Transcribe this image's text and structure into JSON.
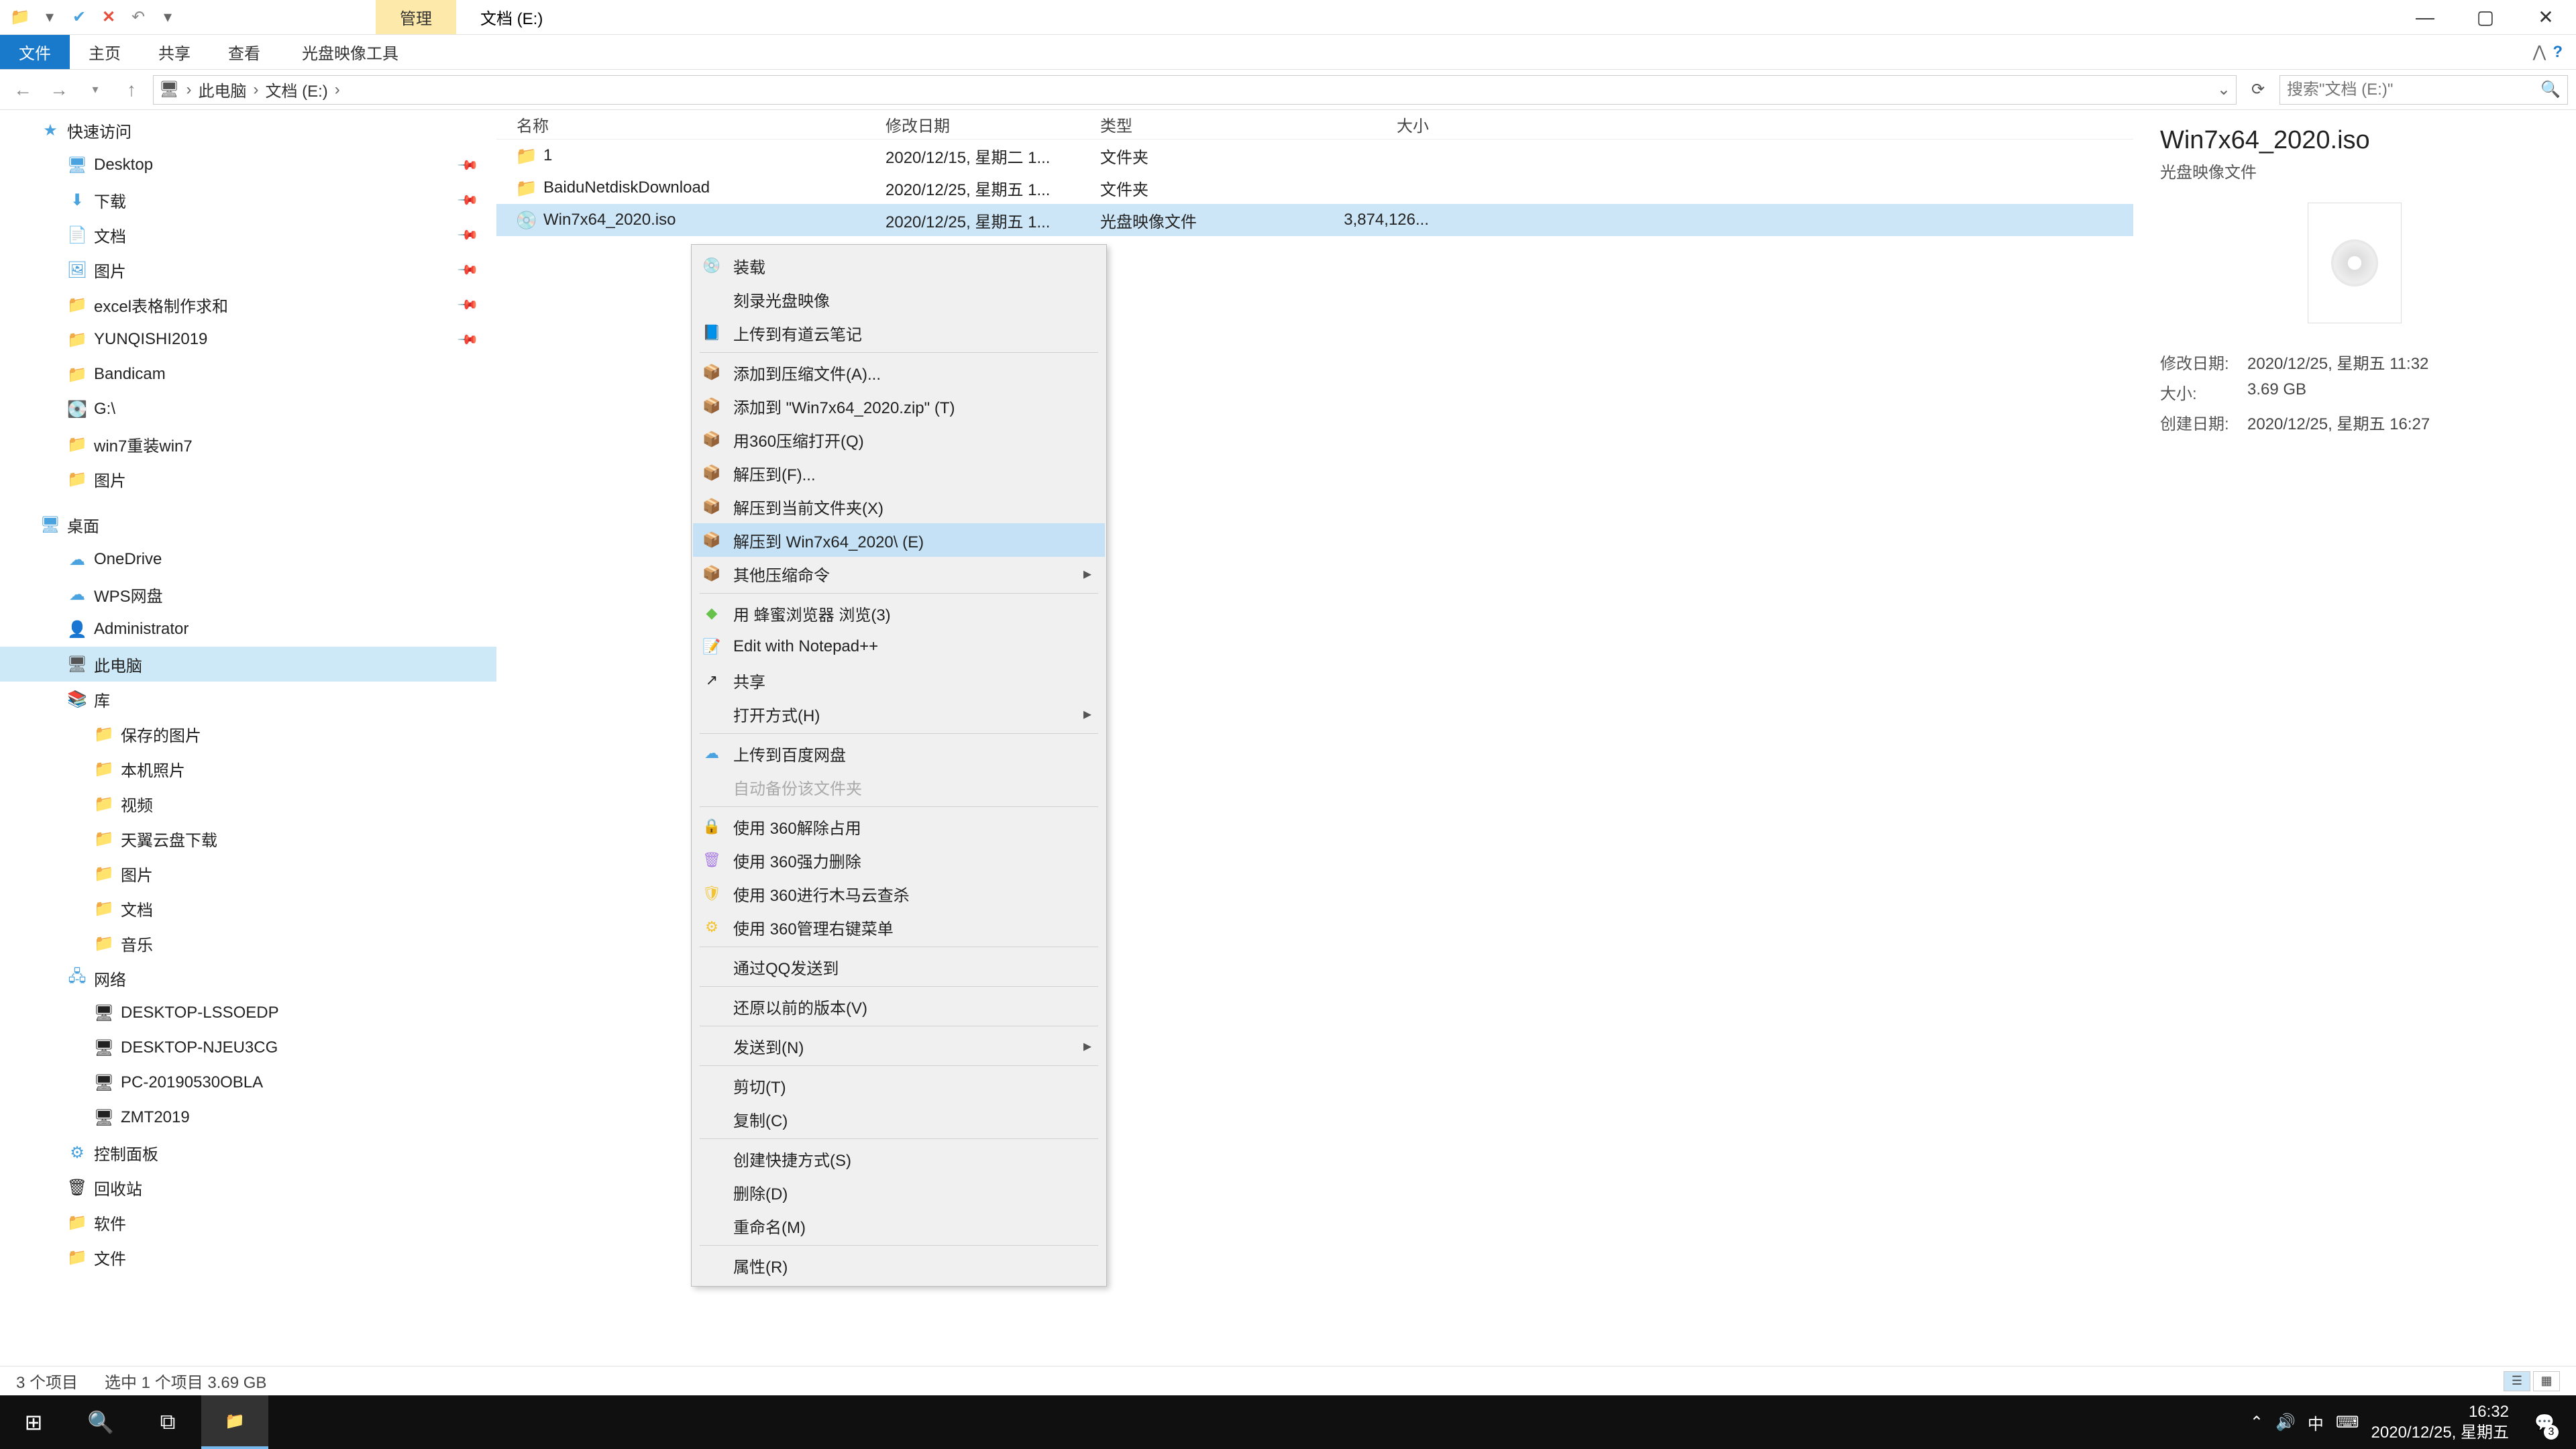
{
  "title_tabs": {
    "ctx": "管理",
    "loc": "文档 (E:)"
  },
  "win": {
    "help": "?"
  },
  "ribbon": {
    "file": "文件",
    "home": "主页",
    "share": "共享",
    "view": "查看",
    "tool": "光盘映像工具"
  },
  "breadcrumb": {
    "a": "此电脑",
    "b": "文档 (E:)"
  },
  "search": {
    "ph": "搜索\"文档 (E:)\""
  },
  "tree": {
    "quick": "快速访问",
    "desktop": "Desktop",
    "down": "下载",
    "docs": "文档",
    "pics": "图片",
    "excel": "excel表格制作求和",
    "yun": "YUNQISHI2019",
    "band": "Bandicam",
    "g": "G:\\",
    "win7": "win7重装win7",
    "pic2": "图片",
    "desk_root": "桌面",
    "onedrive": "OneDrive",
    "wps": "WPS网盘",
    "admin": "Administrator",
    "thispc": "此电脑",
    "lib": "库",
    "savedpic": "保存的图片",
    "localpic": "本机照片",
    "video": "视频",
    "tianyi": "天翼云盘下载",
    "pic3": "图片",
    "doc3": "文档",
    "music": "音乐",
    "net": "网络",
    "pc1": "DESKTOP-LSSOEDP",
    "pc2": "DESKTOP-NJEU3CG",
    "pc3": "PC-20190530OBLA",
    "pc4": "ZMT2019",
    "cp": "控制面板",
    "recycle": "回收站",
    "soft": "软件",
    "file": "文件"
  },
  "cols": {
    "name": "名称",
    "date": "修改日期",
    "type": "类型",
    "size": "大小"
  },
  "rows": {
    "r1": {
      "name": "1",
      "date": "2020/12/15, 星期二 1...",
      "type": "文件夹",
      "size": ""
    },
    "r2": {
      "name": "BaiduNetdiskDownload",
      "date": "2020/12/25, 星期五 1...",
      "type": "文件夹",
      "size": ""
    },
    "r3": {
      "name": "Win7x64_2020.iso",
      "date": "2020/12/25, 星期五 1...",
      "type": "光盘映像文件",
      "size": "3,874,126..."
    }
  },
  "menu": {
    "mount": "装载",
    "burn": "刻录光盘映像",
    "youdao": "上传到有道云笔记",
    "addarch": "添加到压缩文件(A)...",
    "addzip": "添加到 \"Win7x64_2020.zip\" (T)",
    "open360": "用360压缩打开(Q)",
    "extractF": "解压到(F)...",
    "extractHere": "解压到当前文件夹(X)",
    "extractTo": "解压到 Win7x64_2020\\ (E)",
    "other": "其他压缩命令",
    "bee": "用 蜂蜜浏览器 浏览(3)",
    "npp": "Edit with Notepad++",
    "share": "共享",
    "openwith": "打开方式(H)",
    "baidu": "上传到百度网盘",
    "autobk": "自动备份该文件夹",
    "unlock360": "使用 360解除占用",
    "del360": "使用 360强力删除",
    "scan360": "使用 360进行木马云查杀",
    "mgr360": "使用 360管理右键菜单",
    "qq": "通过QQ发送到",
    "restore": "还原以前的版本(V)",
    "sendto": "发送到(N)",
    "cut": "剪切(T)",
    "copy": "复制(C)",
    "shortcut": "创建快捷方式(S)",
    "del": "删除(D)",
    "rename": "重命名(M)",
    "prop": "属性(R)"
  },
  "preview": {
    "title": "Win7x64_2020.iso",
    "sub": "光盘映像文件",
    "k1": "修改日期:",
    "v1": "2020/12/25, 星期五 11:32",
    "k2": "大小:",
    "v2": "3.69 GB",
    "k3": "创建日期:",
    "v3": "2020/12/25, 星期五 16:27"
  },
  "status": {
    "count": "3 个项目",
    "sel": "选中 1 个项目  3.69 GB"
  },
  "tray": {
    "ime": "中",
    "time": "16:32",
    "date": "2020/12/25, 星期五",
    "badge": "3"
  }
}
